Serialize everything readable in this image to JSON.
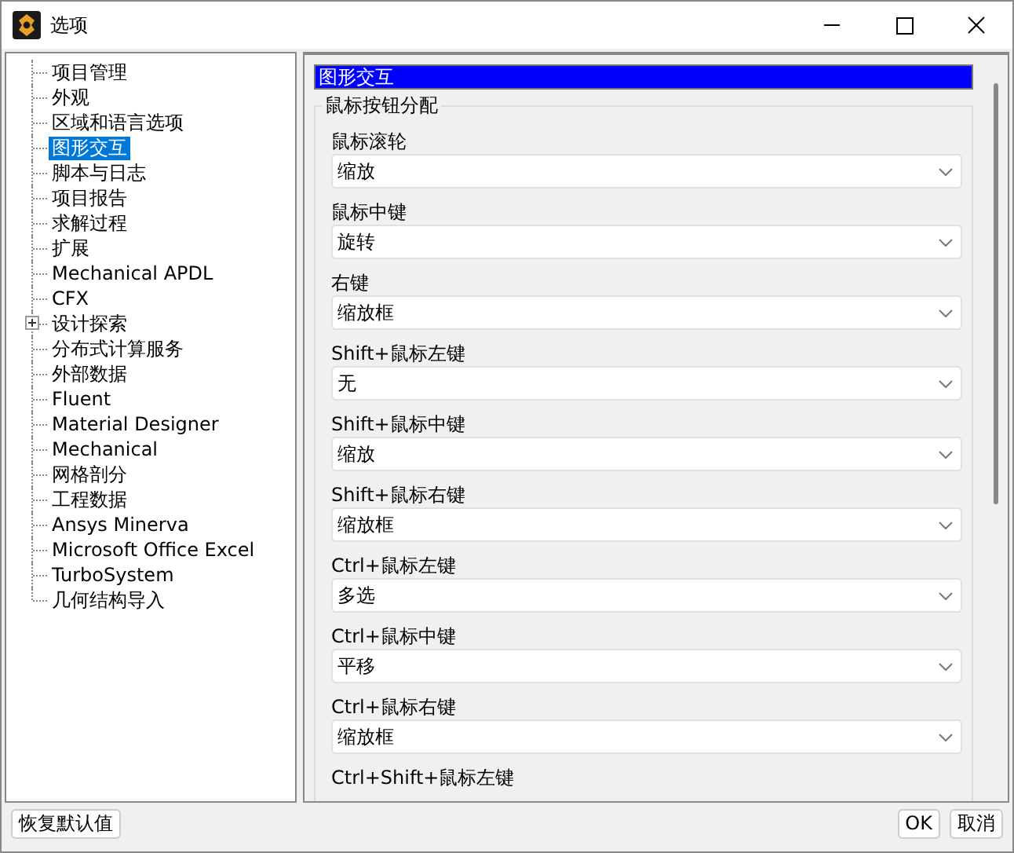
{
  "window": {
    "title": "选项"
  },
  "tree": [
    {
      "label": "项目管理",
      "selected": false
    },
    {
      "label": "外观",
      "selected": false
    },
    {
      "label": "区域和语言选项",
      "selected": false
    },
    {
      "label": "图形交互",
      "selected": true
    },
    {
      "label": "脚本与日志",
      "selected": false
    },
    {
      "label": "项目报告",
      "selected": false
    },
    {
      "label": "求解过程",
      "selected": false
    },
    {
      "label": "扩展",
      "selected": false
    },
    {
      "label": "Mechanical APDL",
      "selected": false
    },
    {
      "label": "CFX",
      "selected": false
    },
    {
      "label": "设计探索",
      "selected": false,
      "expandable": true,
      "expanded": false
    },
    {
      "label": "分布式计算服务",
      "selected": false
    },
    {
      "label": "外部数据",
      "selected": false
    },
    {
      "label": "Fluent",
      "selected": false
    },
    {
      "label": "Material Designer",
      "selected": false
    },
    {
      "label": "Mechanical",
      "selected": false
    },
    {
      "label": "网格剖分",
      "selected": false
    },
    {
      "label": "工程数据",
      "selected": false
    },
    {
      "label": "Ansys Minerva",
      "selected": false
    },
    {
      "label": "Microsoft Office Excel",
      "selected": false
    },
    {
      "label": "TurboSystem",
      "selected": false
    },
    {
      "label": "几何结构导入",
      "selected": false
    }
  ],
  "panel": {
    "header": "图形交互",
    "group": "鼠标按钮分配",
    "fields": [
      {
        "label": "鼠标滚轮",
        "value": "缩放"
      },
      {
        "label": "鼠标中键",
        "value": "旋转"
      },
      {
        "label": "右键",
        "value": "缩放框"
      },
      {
        "label": "Shift+鼠标左键",
        "value": "无"
      },
      {
        "label": "Shift+鼠标中键",
        "value": "缩放"
      },
      {
        "label": "Shift+鼠标右键",
        "value": "缩放框"
      },
      {
        "label": "Ctrl+鼠标左键",
        "value": "多选"
      },
      {
        "label": "Ctrl+鼠标中键",
        "value": "平移"
      },
      {
        "label": "Ctrl+鼠标右键",
        "value": "缩放框"
      },
      {
        "label": "Ctrl+Shift+鼠标左键"
      }
    ]
  },
  "buttons": {
    "reset": "恢复默认值",
    "ok": "OK",
    "cancel": "取消"
  }
}
